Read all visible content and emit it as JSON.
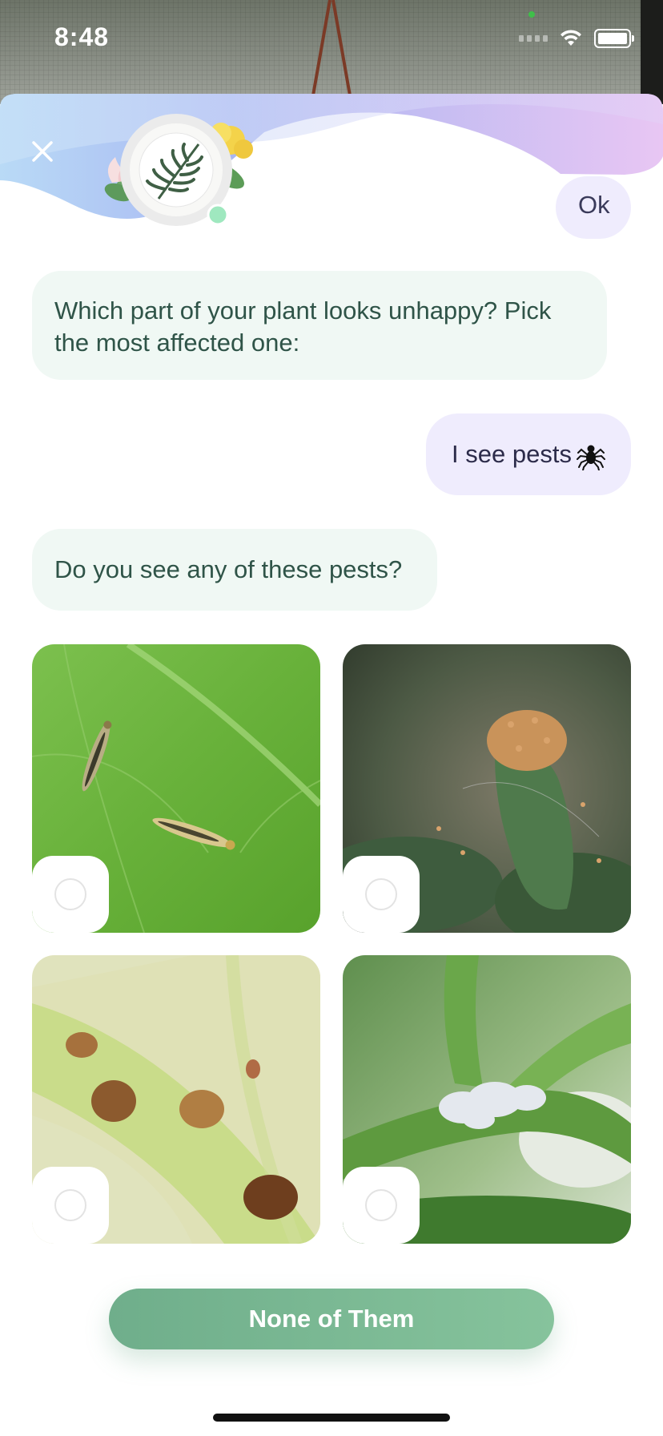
{
  "status_bar": {
    "time": "8:48"
  },
  "header": {
    "close_icon": "close-icon",
    "avatar_icon": "leaf-avatar-icon"
  },
  "chat": {
    "previous_user_reply": "Ok",
    "bot_question_1": "Which part of your plant looks unhappy? Pick the most affected one:",
    "user_reply": "I see pests",
    "user_reply_icon": "spider-icon",
    "bot_question_2": "Do you see any of these pests?"
  },
  "pest_options": [
    {
      "image": "thrips-on-leaf",
      "selected": false
    },
    {
      "image": "spider-mites-on-bud",
      "selected": false
    },
    {
      "image": "scale-insects-on-stem",
      "selected": false
    },
    {
      "image": "mealybug-on-stem",
      "selected": false
    }
  ],
  "actions": {
    "none_label": "None of Them"
  },
  "colors": {
    "accent_green": "#7bb894",
    "bot_bubble": "#f0f8f4",
    "user_bubble": "#efecfd",
    "header_gradient_start": "#b9d8f5",
    "header_gradient_end": "#e6c8f4"
  }
}
